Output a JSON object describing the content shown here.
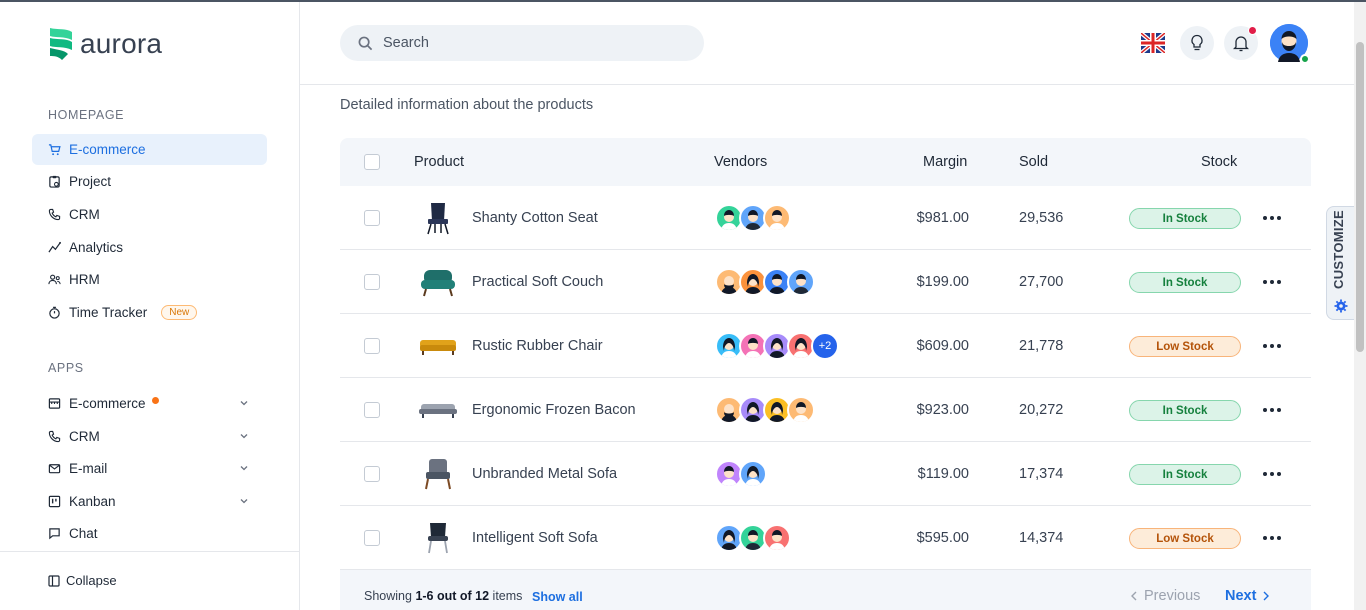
{
  "brand": {
    "name": "aurora"
  },
  "sidebar": {
    "homepage_label": "HOMEPAGE",
    "homepage_items": [
      {
        "label": "E-commerce",
        "icon": "cart-icon",
        "active": true
      },
      {
        "label": "Project",
        "icon": "clipboard-icon"
      },
      {
        "label": "CRM",
        "icon": "phone-icon"
      },
      {
        "label": "Analytics",
        "icon": "analytics-icon"
      },
      {
        "label": "HRM",
        "icon": "users-icon"
      },
      {
        "label": "Time Tracker",
        "icon": "stopwatch-icon",
        "badge": "New"
      }
    ],
    "apps_label": "APPS",
    "apps_items": [
      {
        "label": "E-commerce",
        "icon": "store-icon"
      },
      {
        "label": "CRM",
        "icon": "phone-icon"
      },
      {
        "label": "E-mail",
        "icon": "mail-icon"
      },
      {
        "label": "Kanban",
        "icon": "kanban-icon"
      },
      {
        "label": "Chat",
        "icon": "chat-icon"
      }
    ],
    "collapse_label": "Collapse"
  },
  "header": {
    "search_placeholder": "Search"
  },
  "main": {
    "description": "Detailed information about the products",
    "columns": {
      "product": "Product",
      "vendors": "Vendors",
      "margin": "Margin",
      "sold": "Sold",
      "stock": "Stock"
    },
    "rows": [
      {
        "product": "Shanty Cotton Seat",
        "margin": "$981.00",
        "sold": "29,536",
        "stock": "In Stock"
      },
      {
        "product": "Practical Soft Couch",
        "margin": "$199.00",
        "sold": "27,700",
        "stock": "In Stock"
      },
      {
        "product": "Rustic Rubber Chair",
        "margin": "$609.00",
        "sold": "21,778",
        "stock": "Low Stock",
        "vendors_more": "+2"
      },
      {
        "product": "Ergonomic Frozen Bacon",
        "margin": "$923.00",
        "sold": "20,272",
        "stock": "In Stock"
      },
      {
        "product": "Unbranded Metal Sofa",
        "margin": "$119.00",
        "sold": "17,374",
        "stock": "In Stock"
      },
      {
        "product": "Intelligent Soft Sofa",
        "margin": "$595.00",
        "sold": "14,374",
        "stock": "Low Stock"
      }
    ],
    "footer": {
      "showing_prefix": "Showing",
      "showing_range": "1-6 out of 12",
      "showing_suffix": "items",
      "show_all": "Show all",
      "previous": "Previous",
      "next": "Next"
    }
  },
  "customize_label": "CUSTOMIZE",
  "colors": {
    "accent": "#1d6fe0",
    "in_stock": "#15803d",
    "low_stock": "#b45309"
  }
}
